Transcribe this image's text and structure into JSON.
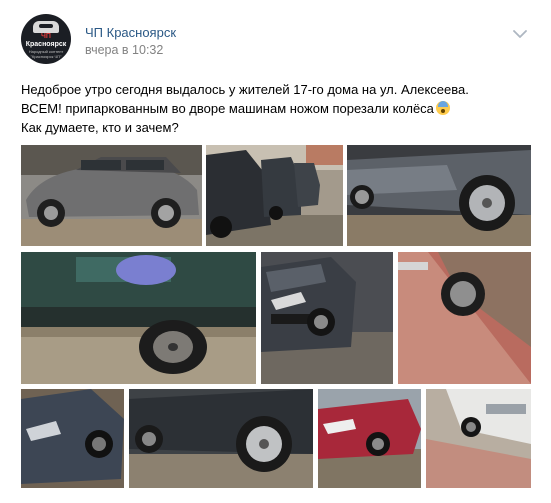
{
  "post": {
    "author": "ЧП Красноярск",
    "time": "вчера в 10:32",
    "text": [
      "Недоброе утро сегодня выдалось у жителей 17-го дома на ул. Алексеева.",
      "ВСЕМ! припаркованным во дворе машинам ножом порезали колёса",
      "Как думаете, кто и зачем?"
    ],
    "emoji": "fearful-face-icon"
  },
  "avatar": {
    "line1": "ЧП",
    "line2": "Красноярск",
    "line3": "Народный контент",
    "line4": "\"Красноярск ЧП\""
  },
  "photos": [
    "photo-1-gray-mercedes",
    "photo-2-dark-cars-row",
    "photo-3-mercedes-wheel",
    "photo-4-green-van-flat-tire",
    "photo-5-kia-front",
    "photo-6-brown-car-wheel",
    "photo-7-dark-sedan",
    "photo-8-silver-wheel",
    "photo-9-red-car",
    "photo-10-white-car"
  ]
}
